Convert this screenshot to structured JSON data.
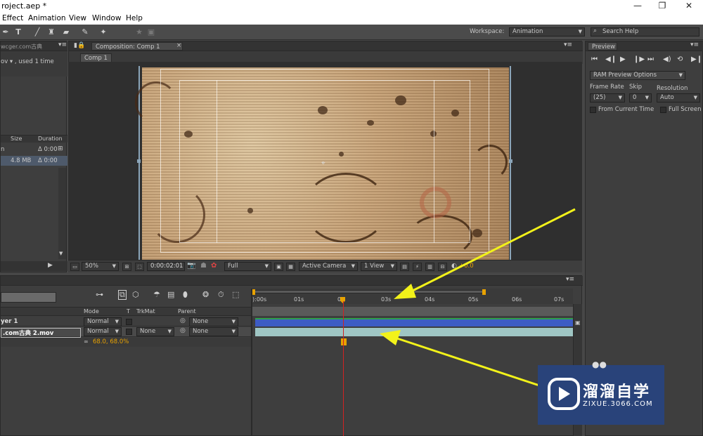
{
  "window": {
    "title": "roject.aep *",
    "minimize": "—",
    "maximize": "❐",
    "close": "✕"
  },
  "menu": [
    "Effect",
    "Animation",
    "View",
    "Window",
    "Help"
  ],
  "toolbar": {
    "workspace_label": "Workspace:",
    "workspace_value": "Animation",
    "search_placeholder": "Search Help"
  },
  "project": {
    "item_name": "wcger.com古典",
    "item_info": "ov ▾ , used 1 time",
    "columns": {
      "size": "Size",
      "duration": "Duration"
    },
    "rows": [
      {
        "name": "n",
        "size": "",
        "duration": "Δ 0:00"
      },
      {
        "name": "",
        "size": "4.8 MB",
        "duration": "Δ 0:00"
      }
    ]
  },
  "composition": {
    "tab_label": "Composition: Comp 1",
    "subtab_label": "Comp 1",
    "zoom": "50%",
    "timecode": "0:00:02:01",
    "resolution": "Full",
    "camera": "Active Camera",
    "views": "1 View",
    "exposure": "+0.0"
  },
  "preview": {
    "tab_label": "Preview",
    "ram_preview": "RAM Preview Options",
    "frame_rate_label": "Frame Rate",
    "skip_label": "Skip",
    "resolution_label": "Resolution",
    "frame_rate_value": "(25)",
    "skip_value": "0",
    "resolution_value": "Auto",
    "from_current_time": "From Current Time",
    "full_screen": "Full Screen"
  },
  "timeline": {
    "columns": {
      "mode": "Mode",
      "t": "T",
      "trkmat": "TrkMat",
      "parent": "Parent"
    },
    "ruler": [
      "):00s",
      "01s",
      "02",
      "03s",
      "04s",
      "05s",
      "06s",
      "07s"
    ],
    "layers": [
      {
        "name": "yer 1",
        "mode": "Normal",
        "trkmat": "",
        "parent": "None"
      },
      {
        "name": ".com古典 2.mov",
        "mode": "Normal",
        "trkmat": "None",
        "parent": "None"
      }
    ],
    "scale_value": "68.0, 68.0%"
  },
  "watermark": {
    "brand": "溜溜自学",
    "url": "ZIXUE.3066.COM"
  },
  "colors": {
    "accent_orange": "#e8a200",
    "layer_blue": "#3d5cc4",
    "layer_teal": "#9fc6c4",
    "playhead": "#d22222",
    "annotation_yellow": "#f2f21a"
  }
}
